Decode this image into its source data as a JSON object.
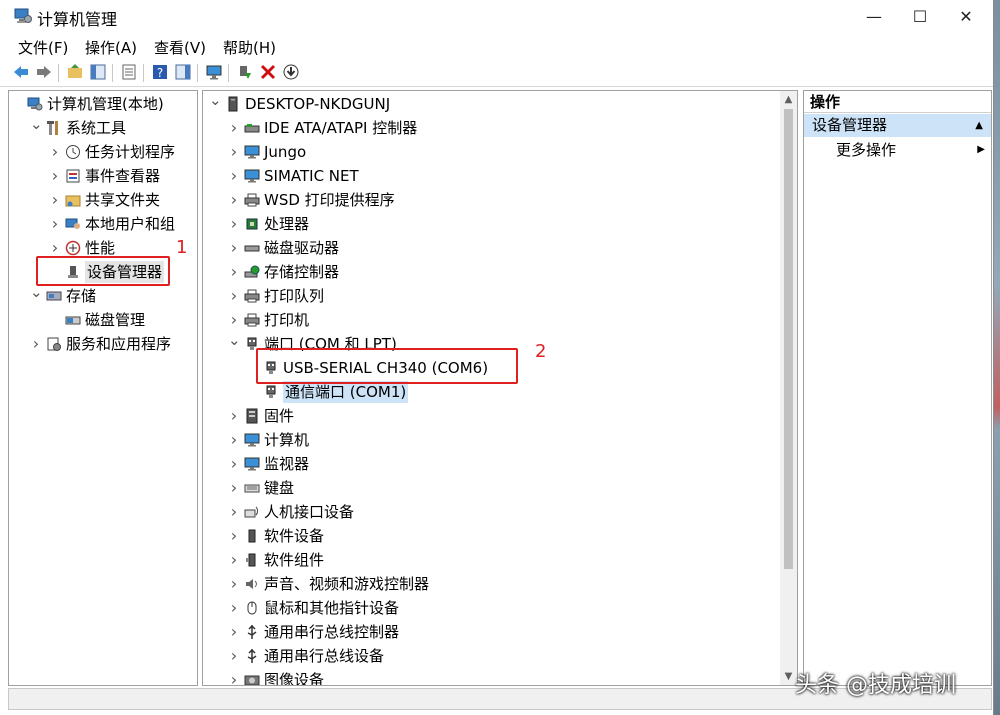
{
  "window": {
    "title": "计算机管理",
    "controls": {
      "minimize": "—",
      "maximize": "☐",
      "close": "✕"
    }
  },
  "menu": [
    "文件(F)",
    "操作(A)",
    "查看(V)",
    "帮助(H)"
  ],
  "toolbar": [
    "back-icon",
    "forward-icon",
    "up-folder-icon",
    "show-tree-icon",
    "properties-icon",
    "help-icon",
    "view-icon",
    "monitor-icon",
    "enable-device-icon",
    "uninstall-icon",
    "update-driver-icon"
  ],
  "left_tree": [
    {
      "label": "计算机管理(本地)",
      "level": 0,
      "arrow": "",
      "icon": "computer-mgmt-icon"
    },
    {
      "label": "系统工具",
      "level": 1,
      "arrow": "v",
      "icon": "tools-icon"
    },
    {
      "label": "任务计划程序",
      "level": 2,
      "arrow": ">",
      "icon": "clock-icon"
    },
    {
      "label": "事件查看器",
      "level": 2,
      "arrow": ">",
      "icon": "event-icon"
    },
    {
      "label": "共享文件夹",
      "level": 2,
      "arrow": ">",
      "icon": "share-folder-icon"
    },
    {
      "label": "本地用户和组",
      "level": 2,
      "arrow": ">",
      "icon": "users-icon"
    },
    {
      "label": "性能",
      "level": 2,
      "arrow": ">",
      "icon": "performance-icon"
    },
    {
      "label": "设备管理器",
      "level": 2,
      "arrow": "",
      "icon": "device-manager-icon",
      "selected": true
    },
    {
      "label": "存储",
      "level": 1,
      "arrow": "v",
      "icon": "storage-icon"
    },
    {
      "label": "磁盘管理",
      "level": 2,
      "arrow": "",
      "icon": "disk-icon"
    },
    {
      "label": "服务和应用程序",
      "level": 1,
      "arrow": ">",
      "icon": "services-icon"
    }
  ],
  "device_tree": [
    {
      "label": "DESKTOP-NKDGUNJ",
      "level": 0,
      "arrow": "v",
      "icon": "computer-icon"
    },
    {
      "label": "IDE ATA/ATAPI 控制器",
      "level": 1,
      "arrow": ">",
      "icon": "ide-icon"
    },
    {
      "label": "Jungo",
      "level": 1,
      "arrow": ">",
      "icon": "monitor-device-icon"
    },
    {
      "label": "SIMATIC NET",
      "level": 1,
      "arrow": ">",
      "icon": "monitor-device-icon"
    },
    {
      "label": "WSD 打印提供程序",
      "level": 1,
      "arrow": ">",
      "icon": "printer-icon"
    },
    {
      "label": "处理器",
      "level": 1,
      "arrow": ">",
      "icon": "cpu-icon"
    },
    {
      "label": "磁盘驱动器",
      "level": 1,
      "arrow": ">",
      "icon": "disk-drive-icon"
    },
    {
      "label": "存储控制器",
      "level": 1,
      "arrow": ">",
      "icon": "storage-ctrl-icon"
    },
    {
      "label": "打印队列",
      "level": 1,
      "arrow": ">",
      "icon": "printer-icon"
    },
    {
      "label": "打印机",
      "level": 1,
      "arrow": ">",
      "icon": "printer-icon"
    },
    {
      "label": "端口 (COM 和 LPT)",
      "level": 1,
      "arrow": "v",
      "icon": "port-icon"
    },
    {
      "label": "USB-SERIAL CH340 (COM6)",
      "level": 2,
      "arrow": "",
      "icon": "port-icon"
    },
    {
      "label": "通信端口 (COM1)",
      "level": 2,
      "arrow": "",
      "icon": "port-icon",
      "selected": true
    },
    {
      "label": "固件",
      "level": 1,
      "arrow": ">",
      "icon": "firmware-icon"
    },
    {
      "label": "计算机",
      "level": 1,
      "arrow": ">",
      "icon": "monitor-device-icon"
    },
    {
      "label": "监视器",
      "level": 1,
      "arrow": ">",
      "icon": "monitor-device-icon"
    },
    {
      "label": "键盘",
      "level": 1,
      "arrow": ">",
      "icon": "keyboard-icon"
    },
    {
      "label": "人机接口设备",
      "level": 1,
      "arrow": ">",
      "icon": "hid-icon"
    },
    {
      "label": "软件设备",
      "level": 1,
      "arrow": ">",
      "icon": "software-device-icon"
    },
    {
      "label": "软件组件",
      "level": 1,
      "arrow": ">",
      "icon": "software-component-icon"
    },
    {
      "label": "声音、视频和游戏控制器",
      "level": 1,
      "arrow": ">",
      "icon": "sound-icon"
    },
    {
      "label": "鼠标和其他指针设备",
      "level": 1,
      "arrow": ">",
      "icon": "mouse-icon"
    },
    {
      "label": "通用串行总线控制器",
      "level": 1,
      "arrow": ">",
      "icon": "usb-icon"
    },
    {
      "label": "通用串行总线设备",
      "level": 1,
      "arrow": ">",
      "icon": "usb-icon"
    },
    {
      "label": "图像设备",
      "level": 1,
      "arrow": ">",
      "icon": "camera-icon"
    }
  ],
  "actions": {
    "header": "操作",
    "selected": "设备管理器",
    "more": "更多操作"
  },
  "annotations": {
    "one": "1",
    "two": "2"
  },
  "watermark": "头条 @技成培训",
  "colors": {
    "selection": "#cde3f7",
    "annotation": "#e02020"
  }
}
